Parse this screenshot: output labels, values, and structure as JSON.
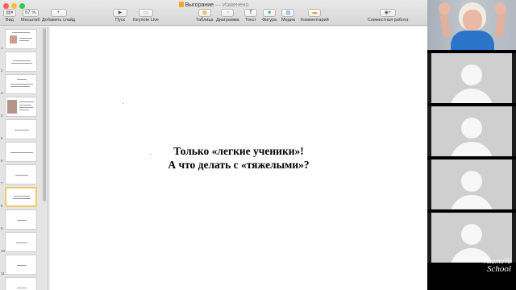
{
  "window": {
    "title": "Выгорание",
    "edited_label": "— Изменено"
  },
  "toolbar": {
    "view_label": "Вид",
    "zoom_value": "67 %",
    "zoom_label": "Масштаб",
    "add_slide_label": "Добавить слайд",
    "play_label": "Пуск",
    "keynote_live_label": "Keynote Live",
    "table_label": "Таблица",
    "chart_label": "Диаграмма",
    "text_label": "Текст",
    "shape_label": "Фигура",
    "media_label": "Медиа",
    "comment_label": "Комментарий",
    "collaborate_label": "Совместная работа"
  },
  "navigator": {
    "slides": [
      {
        "number": "1"
      },
      {
        "number": "2"
      },
      {
        "number": "3"
      },
      {
        "number": "4"
      },
      {
        "number": "5"
      },
      {
        "number": "6"
      },
      {
        "number": "7"
      },
      {
        "number": "8",
        "selected": true
      },
      {
        "number": "9"
      },
      {
        "number": "10"
      },
      {
        "number": "11"
      },
      {
        "number": "12"
      }
    ]
  },
  "slide": {
    "line1": "Только «легкие ученики»!",
    "line2": "А что делать с «тяжелыми»?"
  },
  "video": {
    "watermark_line1": "AsamoVa",
    "watermark_line2": "School"
  }
}
